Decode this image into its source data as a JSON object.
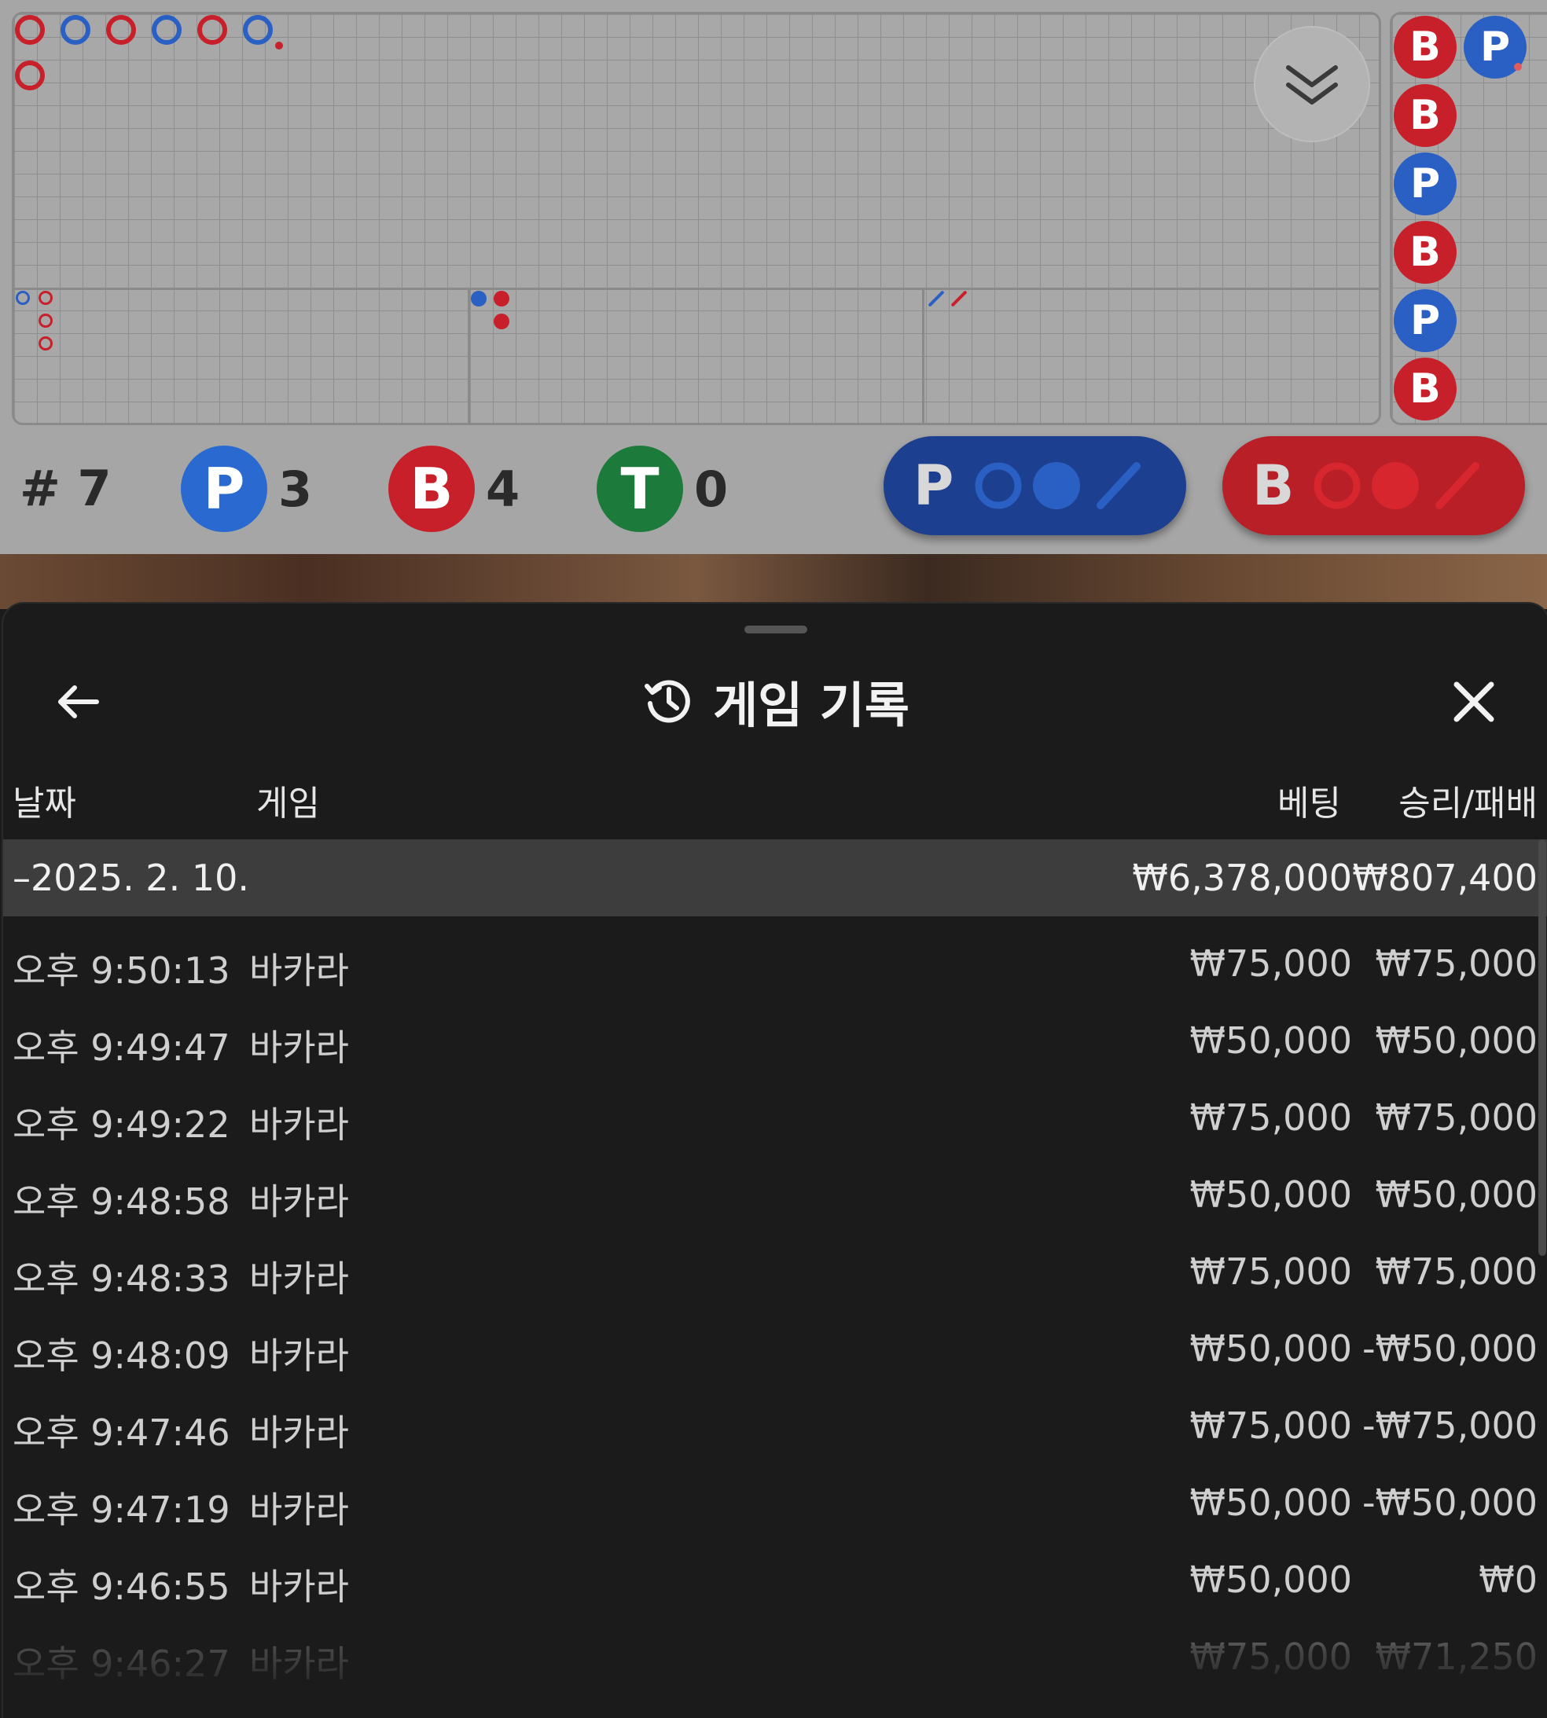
{
  "scoreboard": {
    "round_label": "# 7",
    "stats": [
      {
        "letter": "P",
        "count": "3",
        "color": "#2a6ad0"
      },
      {
        "letter": "B",
        "count": "4",
        "color": "#c8202a"
      },
      {
        "letter": "T",
        "count": "0",
        "color": "#1c7a3a"
      }
    ],
    "predict_buttons": [
      {
        "letter": "P",
        "color": "#1d3f8f"
      },
      {
        "letter": "B",
        "color": "#b81f27"
      }
    ],
    "bead_road": [
      "B",
      "P",
      "B",
      "P",
      "B",
      "P",
      "B"
    ]
  },
  "history": {
    "title": "게임 기록",
    "columns": {
      "date": "날짜",
      "game": "게임",
      "bet": "베팅",
      "result": "승리/패배"
    },
    "date_group": {
      "label": "–2025. 2. 10.",
      "bet": "₩6,378,000",
      "result": "₩807,400"
    },
    "rows": [
      {
        "time": "오후 9:50:13",
        "game": "바카라",
        "bet": "₩75,000",
        "result": "₩75,000"
      },
      {
        "time": "오후 9:49:47",
        "game": "바카라",
        "bet": "₩50,000",
        "result": "₩50,000"
      },
      {
        "time": "오후 9:49:22",
        "game": "바카라",
        "bet": "₩75,000",
        "result": "₩75,000"
      },
      {
        "time": "오후 9:48:58",
        "game": "바카라",
        "bet": "₩50,000",
        "result": "₩50,000"
      },
      {
        "time": "오후 9:48:33",
        "game": "바카라",
        "bet": "₩75,000",
        "result": "₩75,000"
      },
      {
        "time": "오후 9:48:09",
        "game": "바카라",
        "bet": "₩50,000",
        "result": "-₩50,000"
      },
      {
        "time": "오후 9:47:46",
        "game": "바카라",
        "bet": "₩75,000",
        "result": "-₩75,000"
      },
      {
        "time": "오후 9:47:19",
        "game": "바카라",
        "bet": "₩50,000",
        "result": "-₩50,000"
      },
      {
        "time": "오후 9:46:55",
        "game": "바카라",
        "bet": "₩50,000",
        "result": "₩0"
      },
      {
        "time": "오후 9:46:27",
        "game": "바카라",
        "bet": "₩75,000",
        "result": "₩71,250"
      }
    ]
  }
}
